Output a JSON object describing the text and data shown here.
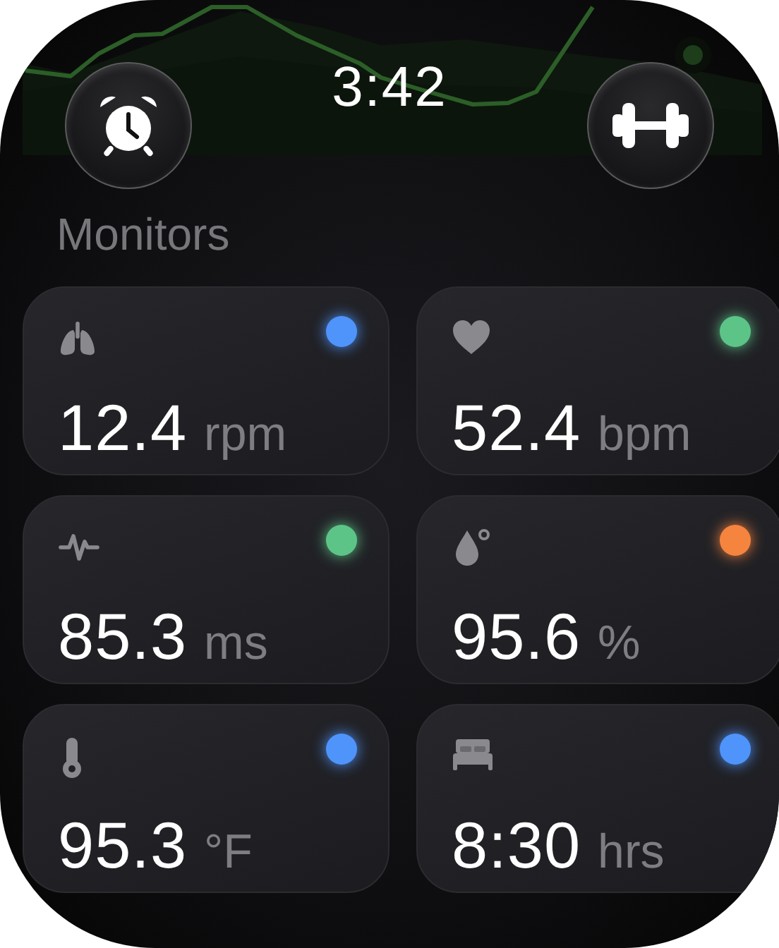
{
  "time": "3:42",
  "section_title": "Monitors",
  "monitors": [
    {
      "kind": "lungs",
      "value": "12.4",
      "unit": "rpm",
      "color": "#4f94fb"
    },
    {
      "kind": "heart",
      "value": "52.4",
      "unit": "bpm",
      "color": "#5dc488"
    },
    {
      "kind": "pulse",
      "value": "85.3",
      "unit": "ms",
      "color": "#5dc488"
    },
    {
      "kind": "drop",
      "value": "95.6",
      "unit": "%",
      "color": "#f5843f"
    },
    {
      "kind": "thermometer",
      "value": "95.3",
      "unit": "°F",
      "color": "#4f94fb"
    },
    {
      "kind": "bed",
      "value": "8:30",
      "unit": "hrs",
      "color": "#4f94fb"
    }
  ]
}
